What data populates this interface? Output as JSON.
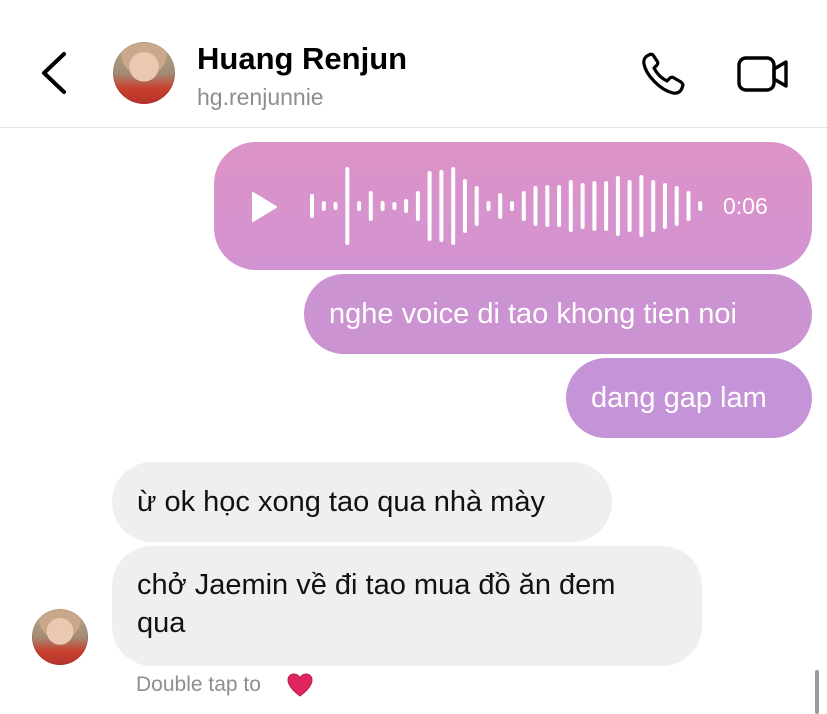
{
  "header": {
    "name": "Huang Renjun",
    "username": "hg.renjunnie",
    "back_icon": "chevron-left-icon",
    "call_icon": "phone-icon",
    "video_icon": "video-camera-icon"
  },
  "messages": {
    "voice": {
      "duration": "0:06",
      "play_icon": "play-icon",
      "color": "#d893cc"
    },
    "outgoing_1": "nghe voice di tao khong tien noi",
    "outgoing_2": "dang gap lam",
    "incoming_1": "ừ ok học xong tao qua nhà mày",
    "incoming_2_line1": "chở Jaemin về đi tao mua đồ ăn đem",
    "incoming_2_line2": "qua"
  },
  "footer": {
    "hint": "Double tap to",
    "heart_icon": "heart-icon",
    "heart_color": "#e0245e"
  },
  "colors": {
    "outgoing_bubble_top": "#dd93c6",
    "outgoing_bubble_bottom": "#c594d8",
    "incoming_bubble": "#efefef",
    "secondary_text": "#8e8e8e"
  }
}
